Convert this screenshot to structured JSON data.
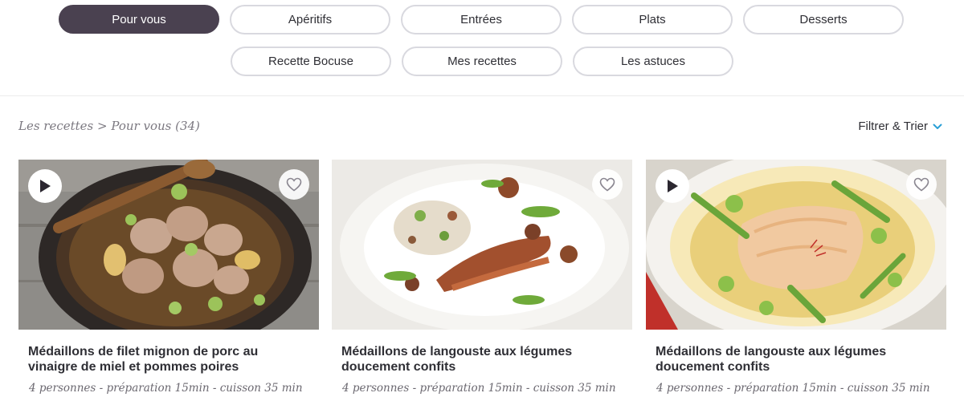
{
  "tabs": [
    {
      "label": "Pour vous",
      "active": true
    },
    {
      "label": "Apéritifs",
      "active": false
    },
    {
      "label": "Entrées",
      "active": false
    },
    {
      "label": "Plats",
      "active": false
    },
    {
      "label": "Desserts",
      "active": false
    },
    {
      "label": "Recette Bocuse",
      "active": false
    },
    {
      "label": "Mes recettes",
      "active": false
    },
    {
      "label": "Les astuces",
      "active": false
    }
  ],
  "breadcrumb": "Les recettes > Pour vous (34)",
  "filter_label": "Filtrer & Trier",
  "accent_color": "#2a9fd6",
  "active_tab_color": "#4a4150",
  "cards": [
    {
      "title": "Médaillons de filet mignon de porc au vinaigre de miel et pommes poires",
      "meta": "4 personnes - préparation 15min - cuisson 35 min",
      "has_video": true,
      "image_icon": "pork-medallions-pan-photo"
    },
    {
      "title": "Médaillons de langouste aux légumes doucement confits",
      "meta": "4 personnes - préparation 15min - cuisson 35 min",
      "has_video": false,
      "image_icon": "langouste-plate-photo"
    },
    {
      "title": "Médaillons de langouste aux légumes doucement confits",
      "meta": "4 personnes - préparation 15min - cuisson 35 min",
      "has_video": true,
      "image_icon": "fish-risotto-plate-photo"
    }
  ]
}
